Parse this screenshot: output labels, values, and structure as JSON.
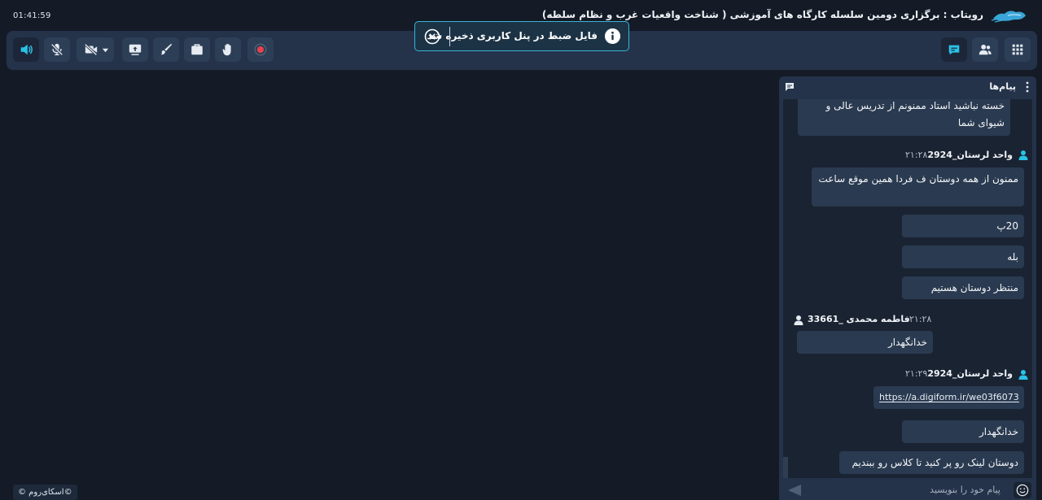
{
  "header": {
    "clock": "01:41:59",
    "room_title": "رویتاب : برگزاری دومین سلسله کارگاه های آموزشی ( شناخت واقعیات غرب و نظام سلطه)",
    "logo_icon": "skyroom-cloud-logo"
  },
  "toolbar": {
    "left_buttons": [
      {
        "icon": "speaker-on-icon",
        "active": true
      },
      {
        "icon": "mic-off-icon"
      },
      {
        "icon": "camera-off-icon",
        "has_dropdown": true
      },
      {
        "icon": "screen-share-icon"
      },
      {
        "icon": "whiteboard-brush-icon"
      },
      {
        "icon": "files-briefcase-icon"
      },
      {
        "icon": "raise-hand-icon"
      },
      {
        "icon": "record-icon"
      }
    ],
    "right_buttons": [
      {
        "icon": "chat-icon",
        "active": true
      },
      {
        "icon": "users-icon"
      },
      {
        "icon": "apps-grid-icon"
      }
    ],
    "accent": "#29c2e6",
    "record_color": "#e8424c"
  },
  "toast": {
    "message": "فایل ضبط در پنل کاربری ذخیره شد",
    "border_color": "#39b4d6"
  },
  "chat": {
    "title": "پیام‌ها",
    "messages": [
      {
        "text": "خسته نباشید استاد ممنونم از تدریس عالی و شیوای شما"
      },
      {
        "sender": "واحد لرستان_2924",
        "time": "۲۱:۲۸"
      },
      {
        "text": "ممنون از همه دوستان ف فردا همین موقع ساعت"
      },
      {
        "text": "20پ"
      },
      {
        "text": "بله"
      },
      {
        "text": "منتظر دوستان هستیم"
      },
      {
        "sender": "فاطمه محمدی _33661",
        "time": "۲۱:۲۸"
      },
      {
        "text": "خدانگهدار"
      },
      {
        "sender": "واحد لرستان_2924",
        "time": "۲۱:۲۹"
      },
      {
        "text": "https://a.digiform.ir/we03f6073"
      },
      {
        "text": "خدانگهدار"
      },
      {
        "text": "دوستان لینک رو پر کنید تا کلاس رو ببندیم"
      }
    ],
    "input_placeholder": "پیام خود را بنویسید",
    "own_user_icon_color": "#29c2e6"
  },
  "footer": {
    "copyright": "©اسکای‌روم ©"
  }
}
